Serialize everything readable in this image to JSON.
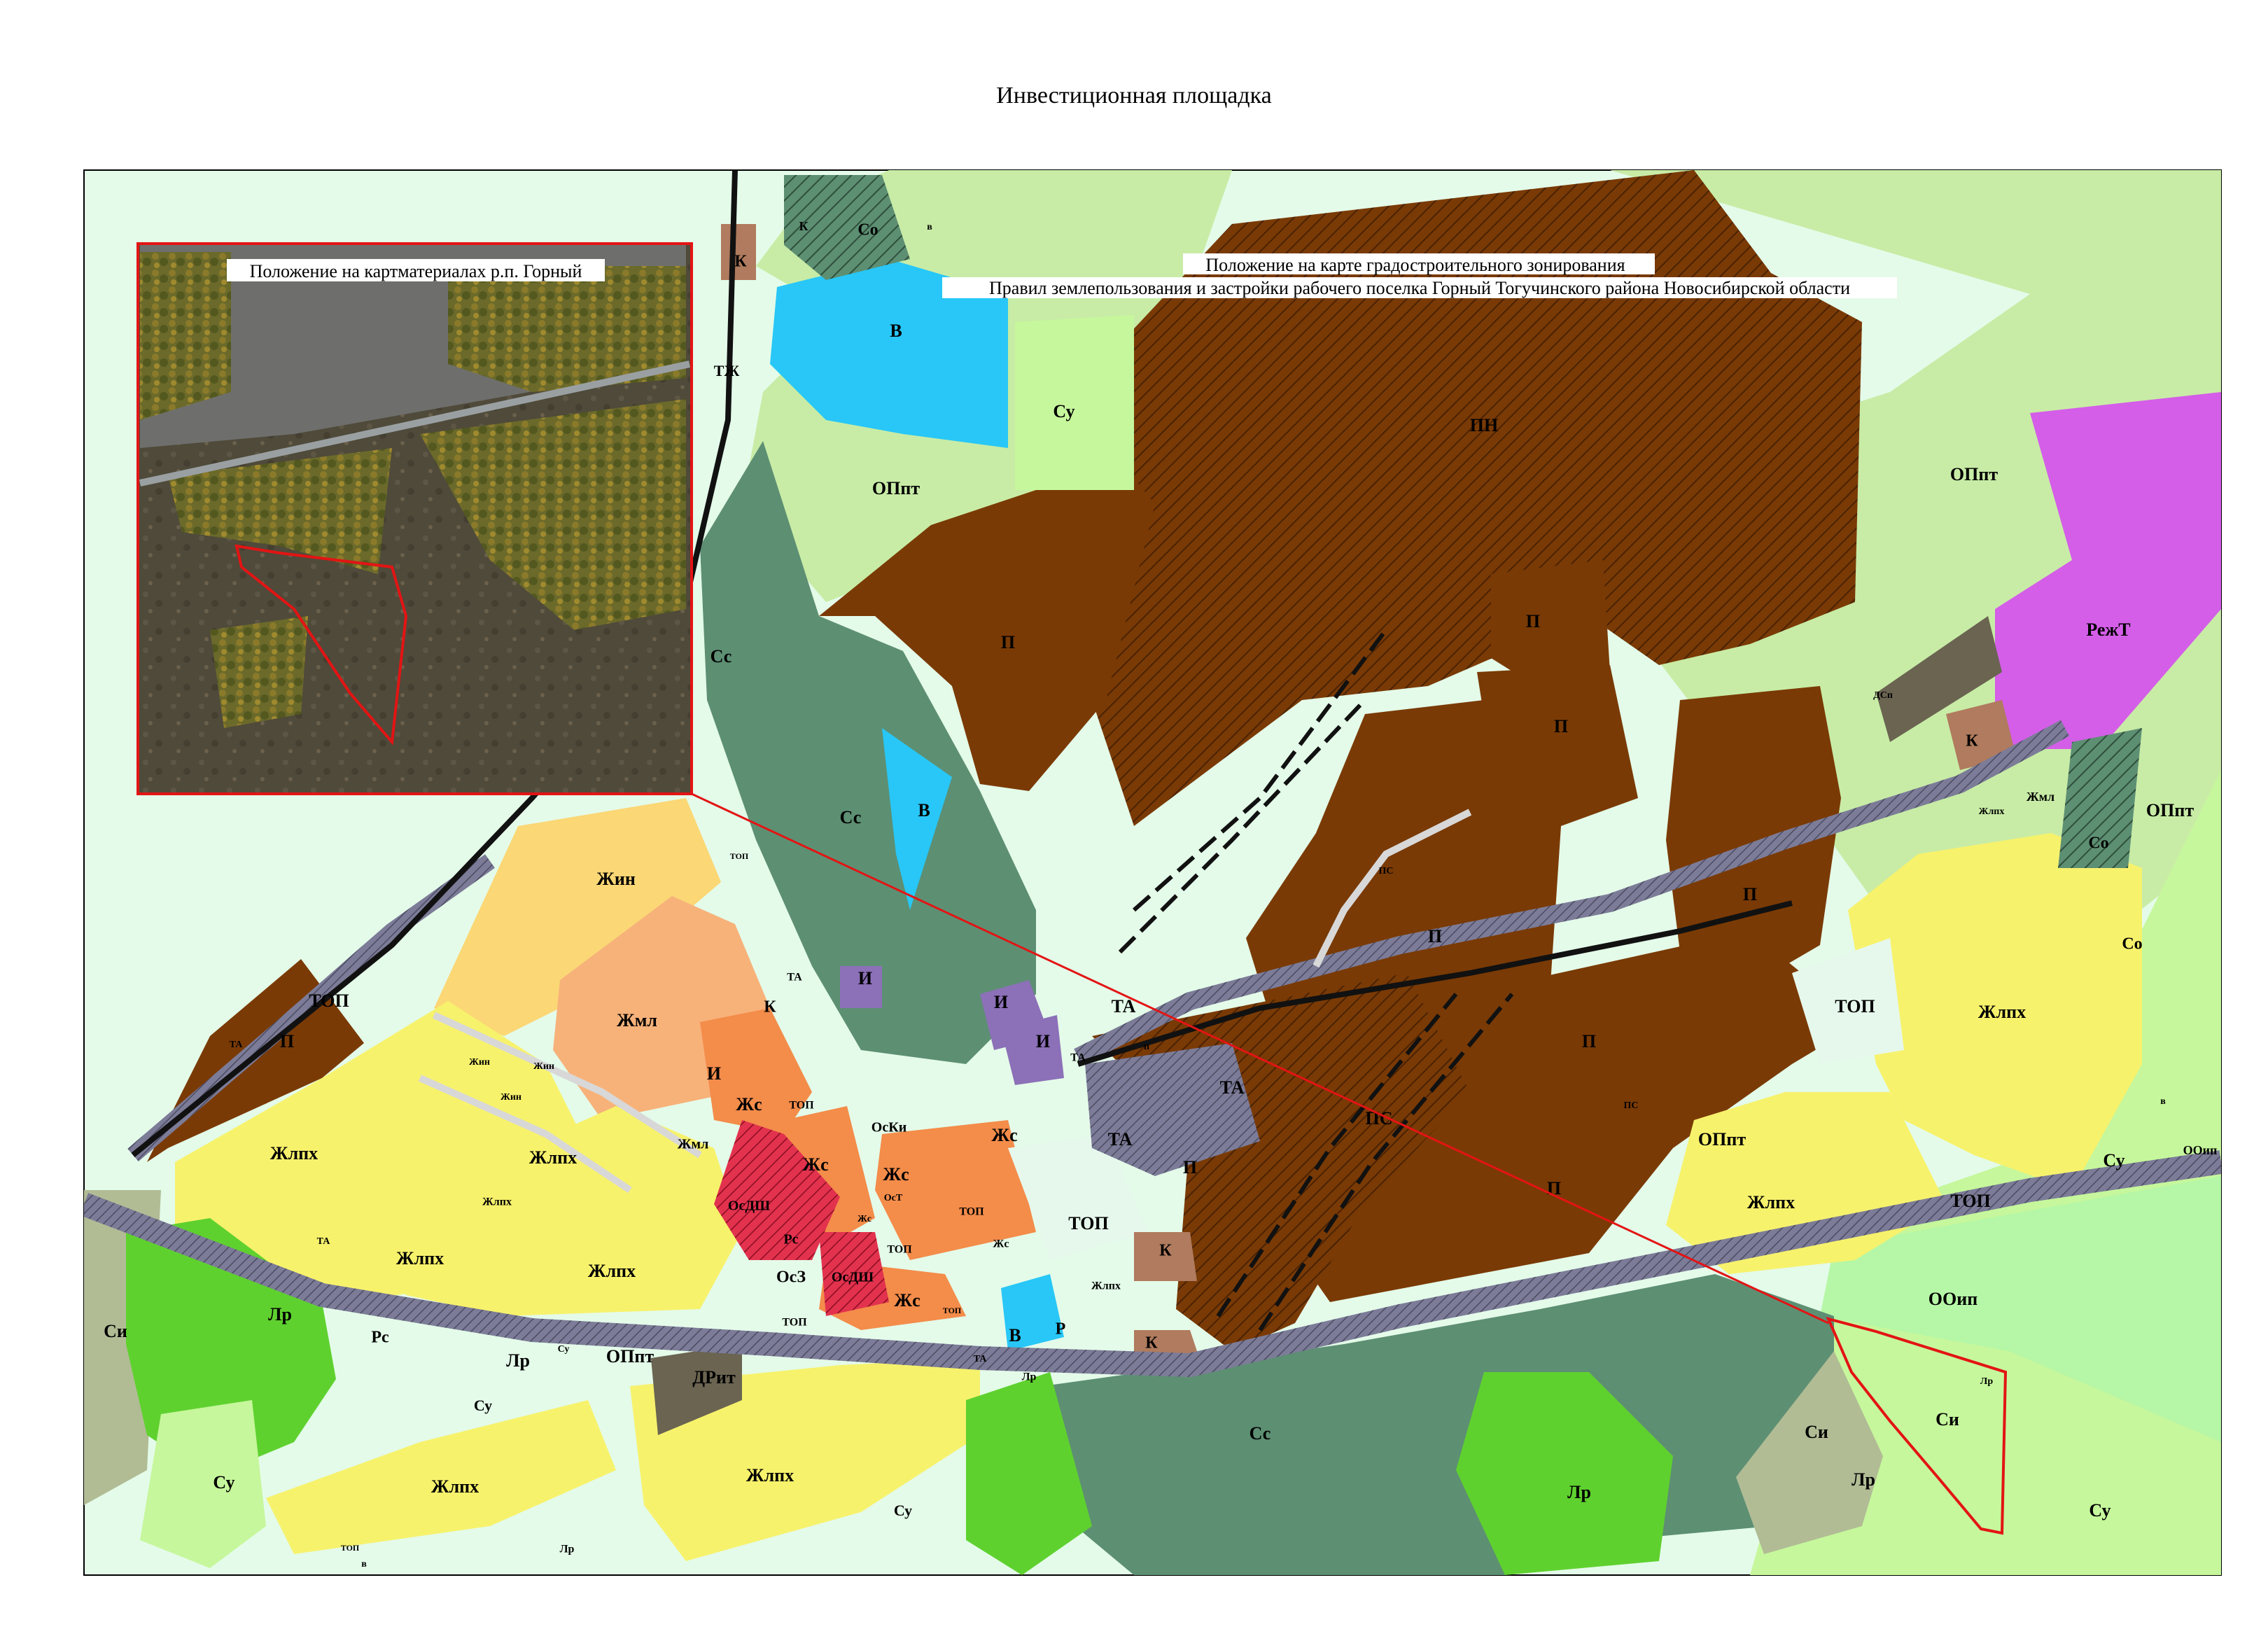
{
  "title": "Инвестиционная площадка",
  "inset": {
    "caption": "Положение на картматериалах р.п. Горный"
  },
  "zoning_caption": {
    "line1": "Положение на карте градостроительного зонирования",
    "line2": "Правил землепользования и застройки рабочего поселка Горный Тогучинского района Новосибирской области"
  },
  "zone_colors": {
    "П": "#7a3a05",
    "ПН": "#6b3305",
    "Жлпх": "#f7f26c",
    "Жин": "#fbd775",
    "Жмл": "#f7b27a",
    "Жс": "#f48c4a",
    "ОПпт": "#c8eca6",
    "Су": "#c6f79c",
    "Лр": "#5fd12f",
    "Сс": "#5d8f73",
    "Си": "#b1bc95",
    "В": "#28c7f7",
    "ТОП": "#e6f8ec",
    "ТА": "#7c7c98",
    "И": "#8c70b8",
    "К": "#b07b5e",
    "Со": "#4a7e5a",
    "РежТ": "#d45ee8",
    "ООип": "#b5f7a6",
    "ДРит": "#6a6451",
    "ОсКи": "#e2324e",
    "highlight": "#e31414"
  },
  "labels": {
    "pn": "ПН",
    "p": "П",
    "zhlph": "Жлпх",
    "zhin": "Жин",
    "zhml": "Жмл",
    "zhs": "Жс",
    "oppt": "ОПпт",
    "su": "Су",
    "lr": "Лр",
    "ss": "Сс",
    "si": "Си",
    "v": "В",
    "top": "ТОП",
    "ta": "ТА",
    "i": "И",
    "k": "К",
    "so": "Со",
    "rezht": "РежТ",
    "ooip": "ООип",
    "drit": "ДРит",
    "rs": "Рс",
    "r": "Р",
    "dsp": "ДСп",
    "ps": "ПС",
    "osdsh": "ОсДШ",
    "osz": "ОсЗ",
    "oski": "ОсКи",
    "ost": "ОсТ",
    "tzh": "ТЖ",
    "p_small": "п",
    "v_small": "в"
  }
}
